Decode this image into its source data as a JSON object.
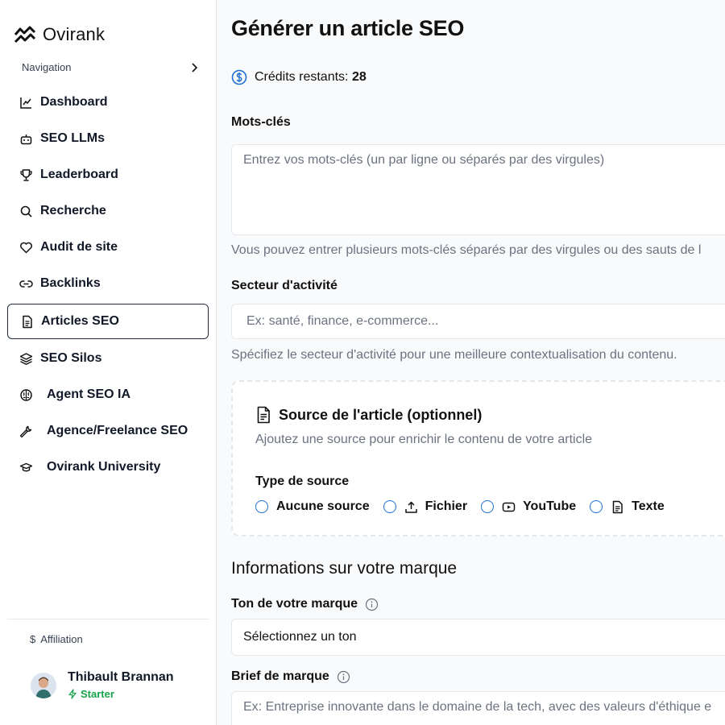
{
  "brand": {
    "name": "Ovirank"
  },
  "nav": {
    "header": "Navigation",
    "items": [
      {
        "label": "Dashboard",
        "icon": "chart-line-icon"
      },
      {
        "label": "SEO LLMs",
        "icon": "bot-icon"
      },
      {
        "label": "Leaderboard",
        "icon": "trophy-icon"
      },
      {
        "label": "Recherche",
        "icon": "search-icon"
      },
      {
        "label": "Audit de site",
        "icon": "heart-icon"
      },
      {
        "label": "Backlinks",
        "icon": "link-icon"
      },
      {
        "label": "Articles SEO",
        "icon": "document-icon",
        "active": true
      },
      {
        "label": "SEO Silos",
        "icon": "layers-icon"
      },
      {
        "label": "Agent SEO IA",
        "icon": "brain-icon"
      },
      {
        "label": "Agence/Freelance SEO",
        "icon": "wrench-icon"
      },
      {
        "label": "Ovirank University",
        "icon": "graduation-cap-icon"
      }
    ],
    "affiliation": {
      "symbol": "$",
      "label": "Affiliation"
    }
  },
  "user": {
    "name": "Thibault Brannan",
    "plan": "Starter"
  },
  "page": {
    "title": "Générer un article SEO",
    "credits_label": "Crédits restants:",
    "credits_value": "28"
  },
  "form": {
    "keywords": {
      "label": "Mots-clés",
      "placeholder": "Entrez vos mots-clés (un par ligne ou séparés par des virgules)",
      "hint": "Vous pouvez entrer plusieurs mots-clés séparés par des virgules ou des sauts de l"
    },
    "sector": {
      "label": "Secteur d'activité",
      "placeholder": "Ex: santé, finance, e-commerce...",
      "hint": "Spécifiez le secteur d'activité pour une meilleure contextualisation du contenu."
    },
    "source": {
      "title": "Source de l'article (optionnel)",
      "subtitle": "Ajoutez une source pour enrichir le contenu de votre article",
      "type_label": "Type de source",
      "options": [
        "Aucune source",
        "Fichier",
        "YouTube",
        "Texte"
      ]
    },
    "brand_section_title": "Informations sur votre marque",
    "tone": {
      "label": "Ton de votre marque",
      "value": "Sélectionnez un ton"
    },
    "brief": {
      "label": "Brief de marque",
      "placeholder": "Ex: Entreprise innovante dans le domaine de la tech, avec des valeurs d'éthique e"
    }
  },
  "colors": {
    "accent": "#1f6fd1",
    "success": "#16a34a",
    "muted": "#6b7280"
  }
}
